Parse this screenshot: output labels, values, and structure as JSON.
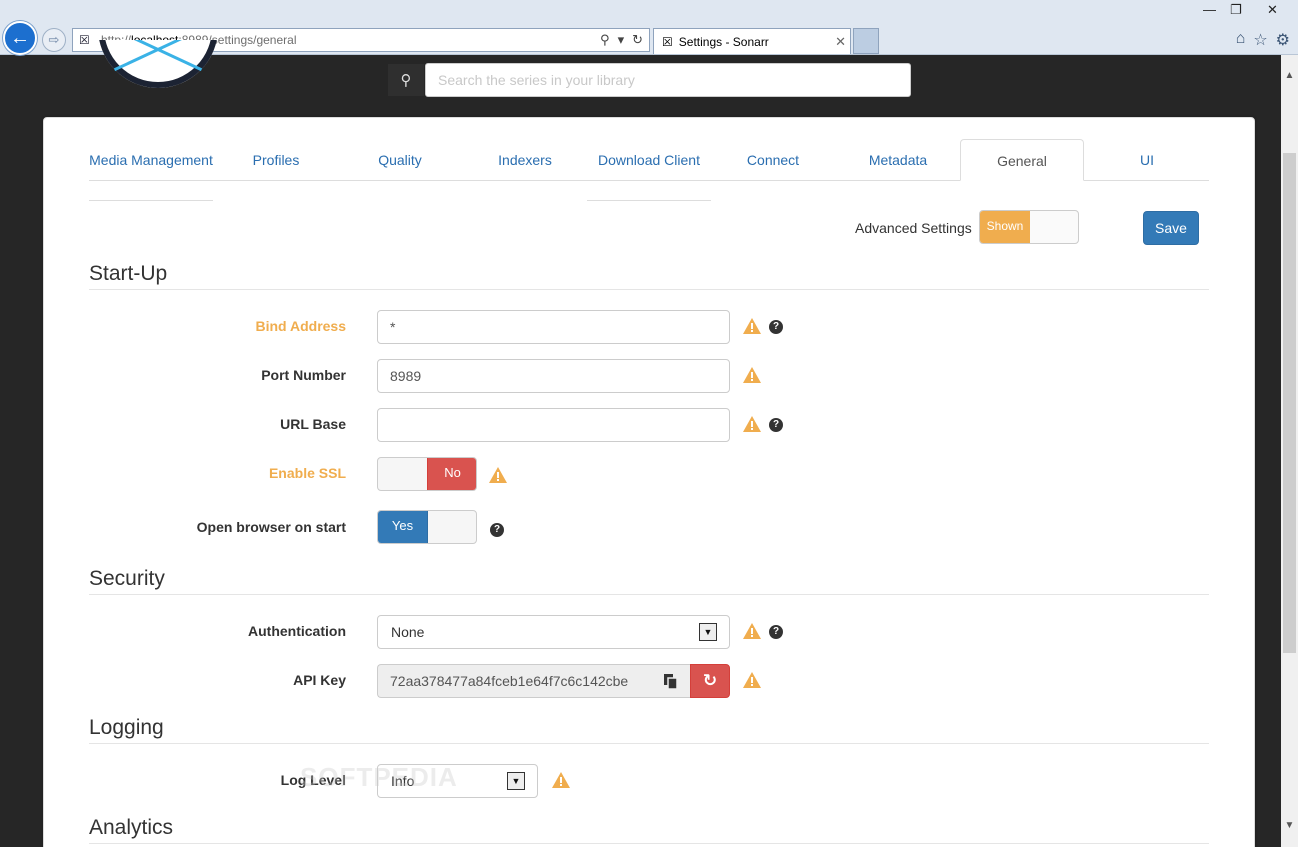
{
  "browser": {
    "url_prefix": "http://",
    "url_host": "localhost",
    "url_rest": ":8989/settings/general",
    "tab_title": "Settings - Sonarr",
    "tab_close": "✕"
  },
  "search": {
    "placeholder": "Search the series in your library"
  },
  "tabs": [
    {
      "label": "Media Management"
    },
    {
      "label": "Profiles"
    },
    {
      "label": "Quality"
    },
    {
      "label": "Indexers"
    },
    {
      "label": "Download Client"
    },
    {
      "label": "Connect"
    },
    {
      "label": "Metadata"
    },
    {
      "label": "General",
      "active": true
    },
    {
      "label": "UI"
    }
  ],
  "toolbar": {
    "advanced_label": "Advanced Settings",
    "advanced_state": "Shown",
    "save_label": "Save"
  },
  "sections": {
    "startup": "Start-Up",
    "security": "Security",
    "logging": "Logging",
    "analytics": "Analytics"
  },
  "fields": {
    "bind_address": {
      "label": "Bind Address",
      "value": "*"
    },
    "port_number": {
      "label": "Port Number",
      "value": "8989"
    },
    "url_base": {
      "label": "URL Base",
      "value": ""
    },
    "enable_ssl": {
      "label": "Enable SSL",
      "state": "No"
    },
    "open_browser": {
      "label": "Open browser on start",
      "state": "Yes"
    },
    "authentication": {
      "label": "Authentication",
      "value": "None"
    },
    "api_key": {
      "label": "API Key",
      "value": "72aa378477a84fceb1e64f7c6c142cbe"
    },
    "log_level": {
      "label": "Log Level",
      "value": "Info"
    }
  },
  "watermark": "SOFTPEDIA",
  "colors": {
    "warning": "#f0ad4e",
    "primary": "#337ab7",
    "danger": "#d9534f",
    "link": "#2a6eb0"
  }
}
